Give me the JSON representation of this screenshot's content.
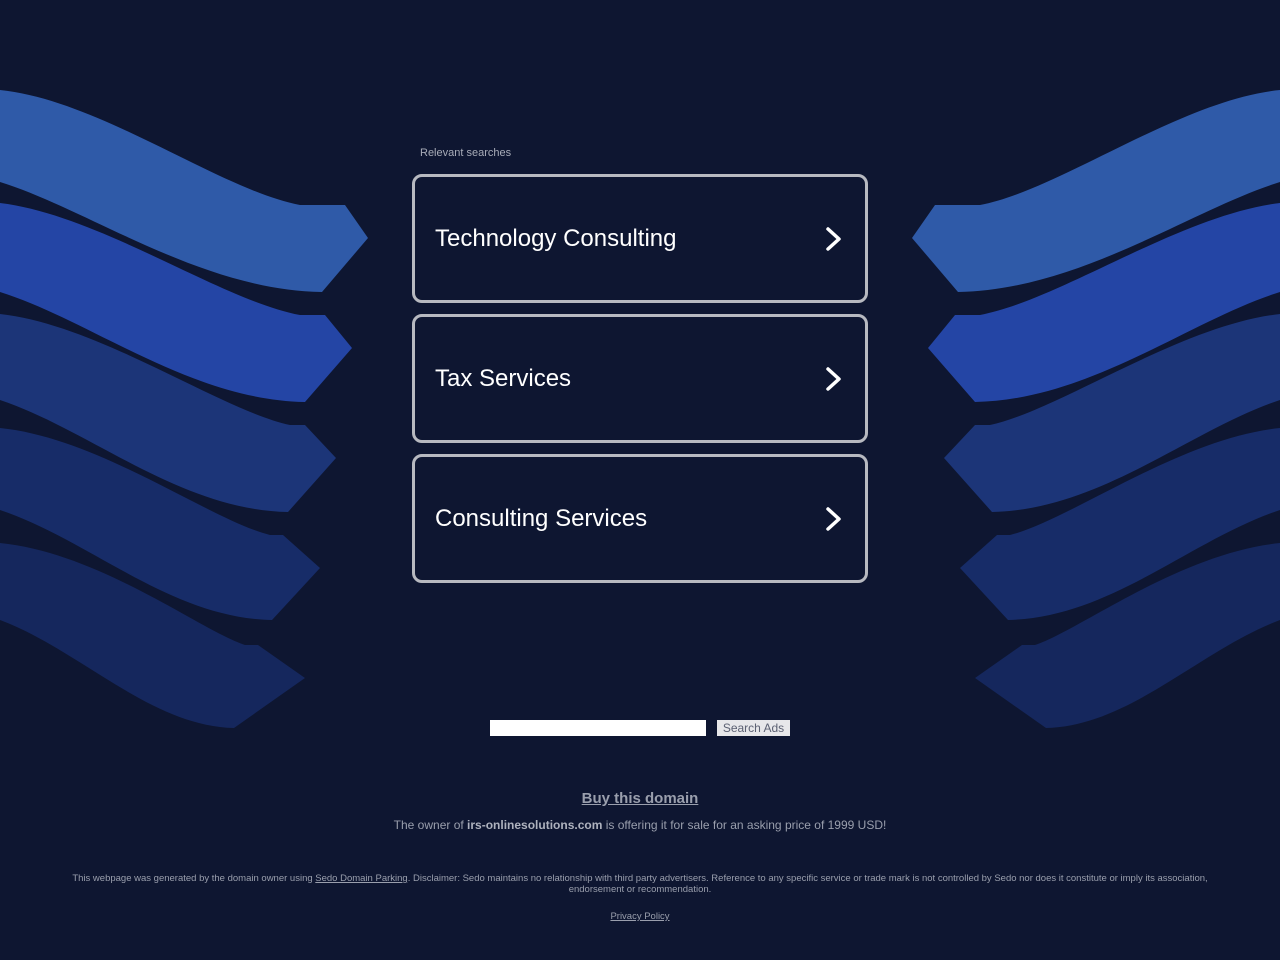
{
  "header": {
    "relevant_searches_label": "Relevant searches"
  },
  "links": [
    {
      "label": "Technology Consulting"
    },
    {
      "label": "Tax Services"
    },
    {
      "label": "Consulting Services"
    }
  ],
  "search": {
    "placeholder": "",
    "value": "",
    "button_label": "Search Ads"
  },
  "sale": {
    "buy_label": "Buy this domain",
    "offer_prefix": "The owner of ",
    "domain": "irs-onlinesolutions.com",
    "offer_suffix": " is offering it for sale for an asking price of 1999 USD!"
  },
  "footer": {
    "generated_prefix": "This webpage was generated by the domain owner using ",
    "sedo_link": "Sedo Domain Parking",
    "disclaimer": ". Disclaimer: Sedo maintains no relationship with third party advertisers. Reference to any specific service or trade mark is not controlled by Sedo nor does it constitute or imply its association, endorsement or recommendation.",
    "privacy_link": "Privacy Policy"
  },
  "colors": {
    "background": "#0e1631",
    "wave_1": "#2f5aa8",
    "wave_2": "#2445a5",
    "wave_3": "#1c3578",
    "wave_4": "#172c68",
    "wave_5": "#15275d",
    "card_border": "#b7b9c0",
    "card_text": "#ffffff",
    "muted_text": "#9a9fad"
  },
  "icons": {
    "chevron": "chevron-right-icon"
  }
}
